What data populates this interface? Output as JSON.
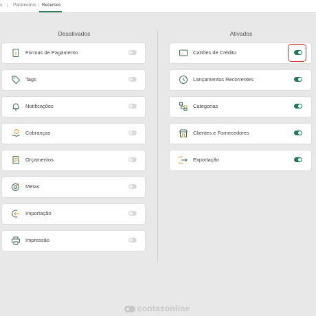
{
  "breadcrumb": {
    "first": "s",
    "second": "Parâmetros",
    "current": "Recursos"
  },
  "disabled_title": "Desativados",
  "enabled_title": "Ativados",
  "disabled_items": [
    {
      "label": "Formas de Pagamento",
      "icon": "payment-receipt-icon",
      "enabled": false
    },
    {
      "label": "Tags",
      "icon": "tag-icon",
      "enabled": false
    },
    {
      "label": "Notificações",
      "icon": "bell-icon",
      "enabled": false
    },
    {
      "label": "Cobranças",
      "icon": "coin-hand-icon",
      "enabled": false
    },
    {
      "label": "Orçamentos",
      "icon": "document-icon",
      "enabled": false
    },
    {
      "label": "Metas",
      "icon": "target-icon",
      "enabled": false
    },
    {
      "label": "Importação",
      "icon": "import-icon",
      "enabled": false
    },
    {
      "label": "Impressão",
      "icon": "printer-icon",
      "enabled": false
    }
  ],
  "enabled_items": [
    {
      "label": "Cartões de Crédito",
      "icon": "credit-card-icon",
      "enabled": true
    },
    {
      "label": "Lançamentos Recorrentes",
      "icon": "clock-icon",
      "enabled": true
    },
    {
      "label": "Categorias",
      "icon": "category-tree-icon",
      "enabled": true
    },
    {
      "label": "Clientes e Fornecedores",
      "icon": "store-icon",
      "enabled": true
    },
    {
      "label": "Exportação",
      "icon": "export-icon",
      "enabled": true
    }
  ],
  "footer": {
    "brand": "contasonline",
    "logo_icon": "contasonline-logo-icon"
  },
  "colors": {
    "accent": "#1f7a5a",
    "highlight": "#d9342b",
    "toggle_off": "#d8d8d8",
    "icon": "#3b6e57",
    "icon_accent": "#d9a33a"
  }
}
